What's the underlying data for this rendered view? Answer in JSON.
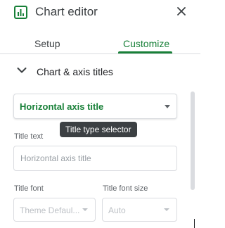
{
  "header": {
    "title": "Chart editor",
    "icon": "chart-icon",
    "close_icon": "close-icon"
  },
  "tabs": [
    {
      "label": "Setup",
      "active": false
    },
    {
      "label": "Customize",
      "active": true
    }
  ],
  "section": {
    "label": "Chart & axis titles",
    "expanded": true
  },
  "title_type": {
    "value": "Horizontal axis title"
  },
  "tooltip": {
    "text": "Title type selector"
  },
  "title_text": {
    "label": "Title text",
    "value": "",
    "placeholder": "Horizontal axis title"
  },
  "title_font": {
    "label": "Title font",
    "value": "Theme Defaul..."
  },
  "title_font_size": {
    "label": "Title font size",
    "value": "Auto"
  },
  "colors": {
    "accent": "#188038",
    "text": "#202124",
    "muted": "#5f6368",
    "border": "#dadce0",
    "disabled": "#bdc1c6",
    "tooltip_bg": "#3c4043"
  }
}
